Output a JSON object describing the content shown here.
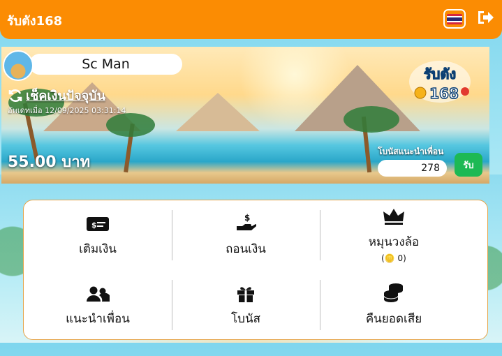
{
  "header": {
    "brand": "รับตัง168",
    "language_icon": "thai-flag-icon",
    "logout_icon": "logout-icon"
  },
  "profile": {
    "name": "Sc Man",
    "refresh_label": "เช็คเงินปัจจุบัน",
    "updated_text": "อัพเดทเมื่อ 12/09/2025 03:31:14",
    "balance": "55.00 บาท"
  },
  "bonus_referral": {
    "label": "โบนัสแนะนำเพื่อน",
    "value": "278",
    "button_label": "รับ"
  },
  "menu": {
    "items": [
      {
        "label": "เติมเงิน",
        "icon": "money-bill-icon"
      },
      {
        "label": "ถอนเงิน",
        "icon": "hand-dollar-icon"
      },
      {
        "label": "หมุนวงล้อ",
        "icon": "crown-icon",
        "sub": "(🪙 0)"
      },
      {
        "label": "แนะนำเพื่อน",
        "icon": "users-icon"
      },
      {
        "label": "โบนัส",
        "icon": "gift-icon"
      },
      {
        "label": "คืนยอดเสีย",
        "icon": "coins-icon"
      }
    ]
  },
  "colors": {
    "header": "#fb8c03",
    "accent_green": "#1db954",
    "card_border": "#e6a54a"
  }
}
